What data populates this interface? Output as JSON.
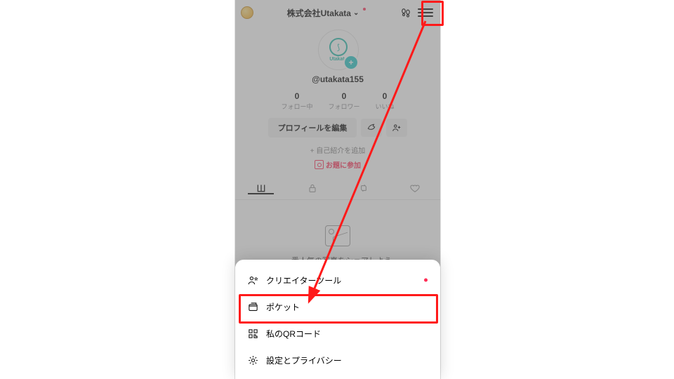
{
  "header": {
    "title": "株式会社Utakata",
    "caret": "⌄"
  },
  "profile": {
    "logo_text": "Utakata",
    "handle": "@utakata155",
    "stats": [
      {
        "n": "0",
        "l": "フォロー中"
      },
      {
        "n": "0",
        "l": "フォロワー"
      },
      {
        "n": "0",
        "l": "いいね"
      }
    ],
    "edit_label": "プロフィールを編集",
    "add_bio": "+ 自己紹介を追加",
    "topic": "お題に参加"
  },
  "feed_prompt": "一番人気の写真をシェアしよう",
  "sheet": {
    "items": [
      {
        "label": "クリエイターツール",
        "dot": true
      },
      {
        "label": "ポケット",
        "dot": false
      },
      {
        "label": "私のQRコード",
        "dot": false
      },
      {
        "label": "設定とプライバシー",
        "dot": false
      }
    ]
  }
}
